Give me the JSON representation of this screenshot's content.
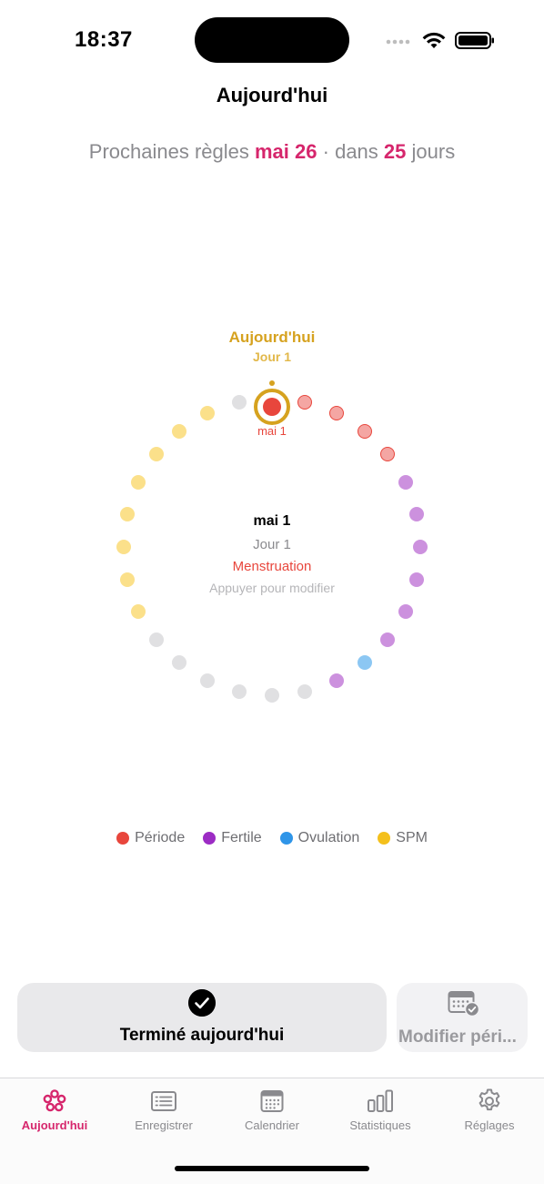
{
  "status_bar": {
    "time": "18:37"
  },
  "header": {
    "title": "Aujourd'hui",
    "next_label": "Prochaines règles",
    "next_date": "mai 26",
    "separator": "·",
    "in_label": "dans",
    "days_count": "25",
    "days_label": "jours"
  },
  "cycle": {
    "today_label": "Aujourd'hui",
    "today_day": "Jour 1",
    "today_date": "mai 1",
    "detail": {
      "date": "mai 1",
      "day": "Jour 1",
      "phase": "Menstruation",
      "hint": "Appuyer pour modifier"
    },
    "day_phases": [
      "period",
      "period",
      "period",
      "period",
      "period",
      "fertile",
      "fertile",
      "fertile",
      "fertile",
      "fertile",
      "fertile",
      "ovulation",
      "fertile",
      "none",
      "none",
      "none",
      "none",
      "none",
      "none",
      "pms",
      "pms",
      "pms",
      "pms",
      "pms",
      "pms",
      "pms",
      "pms",
      "none"
    ]
  },
  "colors": {
    "accent": "#d6266c",
    "today": "#d6a21f",
    "period": "#e8463c",
    "fertile": "#9c2cc4",
    "ovulation": "#2f95e8",
    "pms": "#f4c01c",
    "period_dot": "#f4a6a3",
    "fertile_dot": "#cc91de",
    "ovulation_dot": "#8cc7f3",
    "pms_dot": "#fbe08a",
    "none_dot": "#e0e0e2"
  },
  "legend": [
    {
      "label": "Période",
      "color": "#e8463c"
    },
    {
      "label": "Fertile",
      "color": "#9c2cc4"
    },
    {
      "label": "Ovulation",
      "color": "#2f95e8"
    },
    {
      "label": "SPM",
      "color": "#f4c01c"
    }
  ],
  "actions": {
    "done_label": "Terminé aujourd'hui",
    "done_icon": "checkmark-circle-icon",
    "edit_label": "Modifier péri...",
    "edit_icon": "calendar-check-icon"
  },
  "tabs": [
    {
      "label": "Aujourd'hui",
      "icon": "flower-icon",
      "active": true
    },
    {
      "label": "Enregistrer",
      "icon": "list-icon",
      "active": false
    },
    {
      "label": "Calendrier",
      "icon": "calendar-icon",
      "active": false
    },
    {
      "label": "Statistiques",
      "icon": "bar-chart-icon",
      "active": false
    },
    {
      "label": "Réglages",
      "icon": "gear-icon",
      "active": false
    }
  ]
}
